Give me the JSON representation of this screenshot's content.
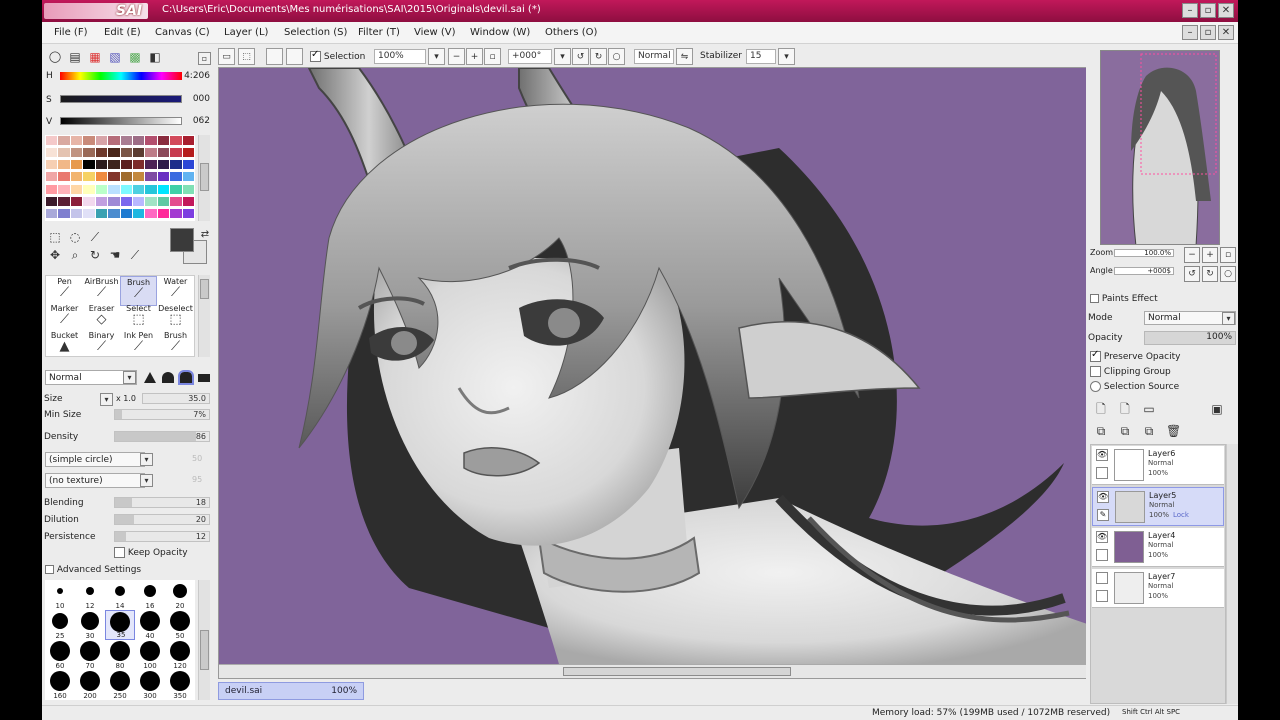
{
  "window": {
    "app_name": "SAI",
    "path": "C:\\Users\\Eric\\Documents\\Mes numérisations\\SAI\\2015\\Originals\\devil.sai (*)"
  },
  "menu": [
    "File (F)",
    "Edit (E)",
    "Canvas (C)",
    "Layer (L)",
    "Selection (S)",
    "Filter (T)",
    "View (V)",
    "Window (W)",
    "Others (O)"
  ],
  "toolbar": {
    "selection_label": "Selection",
    "zoom_value": "100%",
    "angle_value": "+000°",
    "blend_mode": "Normal",
    "stabilizer_label": "Stabilizer",
    "stabilizer_value": "15"
  },
  "color_panel": {
    "h_label": "H",
    "h_value": "4:206",
    "s_label": "S",
    "s_value": "000",
    "v_label": "V",
    "v_value": "062",
    "palette_colors": [
      "#f4c9c9",
      "#d9a9a0",
      "#e7b5a7",
      "#c98b7a",
      "#d7a4a8",
      "#b66d7a",
      "#a97d92",
      "#9d6d86",
      "#b34f6e",
      "#8a2b3e",
      "#d34a5b",
      "#a81f2f",
      "#f7e2d6",
      "#e4c3b1",
      "#c19482",
      "#9a6a58",
      "#6e3a2c",
      "#4a261a",
      "#7a5546",
      "#5b3c31",
      "#bd7c88",
      "#8c495a",
      "#c73b4f",
      "#b51d1d",
      "#f6cfb3",
      "#f1b888",
      "#e79a4e",
      "#000000",
      "#2b1b1b",
      "#3e241c",
      "#5b1e1e",
      "#7d2b2b",
      "#4c2255",
      "#2d1a4a",
      "#1c2d8a",
      "#2c47d6",
      "#f0a6a6",
      "#e9796f",
      "#f2b46e",
      "#f6d264",
      "#f08a3e",
      "#82352a",
      "#a06b2d",
      "#c3883d",
      "#7f4aa3",
      "#6a2fc2",
      "#3b6be0",
      "#61b3f1",
      "#ff9aa2",
      "#ffb3ba",
      "#ffd6a5",
      "#ffffba",
      "#baffc9",
      "#bae1ff",
      "#7df9ff",
      "#4dd0e1",
      "#26c6da",
      "#00e5ff",
      "#3fd0a8",
      "#7fe0b5",
      "#3b1a2a",
      "#5c1f34",
      "#8c1f3a",
      "#f2d9ee",
      "#c19fe0",
      "#9f8ad6",
      "#7b68ee",
      "#b8b8ff",
      "#a1e3c5",
      "#60c9a3",
      "#e34d8e",
      "#c2185b",
      "#a9a9d9",
      "#7f7fcf",
      "#c4c4ea",
      "#e0e0f7",
      "#3aa1b2",
      "#4b8ccf",
      "#1f7bd1",
      "#1fb7e0",
      "#ff69c2",
      "#ff2a9a",
      "#a33ad1",
      "#7c3ee0"
    ]
  },
  "brushes": [
    {
      "name": "Pen"
    },
    {
      "name": "AirBrush"
    },
    {
      "name": "Brush"
    },
    {
      "name": "Water"
    },
    {
      "name": "Marker"
    },
    {
      "name": "Eraser"
    },
    {
      "name": "Select"
    },
    {
      "name": "Deselect"
    },
    {
      "name": "Bucket"
    },
    {
      "name": "Binary"
    },
    {
      "name": "Ink Pen"
    },
    {
      "name": "Brush"
    }
  ],
  "brush_settings": {
    "blend_mode": "Normal",
    "size_label": "Size",
    "size_mult": "x 1.0",
    "size_value": "35.0",
    "min_size_label": "Min Size",
    "min_size_value": "7%",
    "min_size_fill": 0.07,
    "density_label": "Density",
    "density_value": "86",
    "density_fill": 0.86,
    "shape": "(simple circle)",
    "shape_value": "50",
    "texture": "(no texture)",
    "texture_value": "95",
    "blending_label": "Blending",
    "blending_value": "18",
    "blending_fill": 0.18,
    "dilution_label": "Dilution",
    "dilution_value": "20",
    "dilution_fill": 0.2,
    "persistence_label": "Persistence",
    "persistence_value": "12",
    "persistence_fill": 0.12,
    "keep_opacity_label": "Keep Opacity",
    "advanced_label": "Advanced Settings"
  },
  "brush_sizes": [
    "10",
    "12",
    "14",
    "16",
    "20",
    "25",
    "30",
    "35",
    "40",
    "50",
    "60",
    "70",
    "80",
    "100",
    "120",
    "160",
    "200",
    "250",
    "300",
    "350"
  ],
  "navigator": {
    "zoom_label": "Zoom",
    "zoom_value": "100.0%",
    "angle_label": "Angle",
    "angle_value": "+000$"
  },
  "layer_props": {
    "paint_effect_label": "Paints Effect",
    "mode_label": "Mode",
    "mode_value": "Normal",
    "opacity_label": "Opacity",
    "opacity_value": "100%",
    "preserve_opacity": "Preserve Opacity",
    "clipping_group": "Clipping Group",
    "selection_source": "Selection Source"
  },
  "layers": [
    {
      "name": "Layer6",
      "mode": "Normal",
      "opacity": "100%",
      "tag": "",
      "thumb": "#ffffff"
    },
    {
      "name": "Layer5",
      "mode": "Normal",
      "opacity": "100%",
      "tag": "Lock",
      "thumb": "#d8d8d8"
    },
    {
      "name": "Layer4",
      "mode": "Normal",
      "opacity": "100%",
      "tag": "",
      "thumb": "#7f5f93"
    },
    {
      "name": "Layer7",
      "mode": "Normal",
      "opacity": "100%",
      "tag": "",
      "thumb": "#eeeeee"
    }
  ],
  "document_tab": {
    "name": "devil.sai",
    "zoom": "100%"
  },
  "status": {
    "memory": "Memory load: 57% (199MB used / 1072MB reserved)",
    "keys": "Shift Ctrl Alt SPC"
  },
  "colors": {
    "canvas_bg": "#80649a",
    "title_bar": "#a0124c",
    "selection": "#d6dbf8"
  }
}
